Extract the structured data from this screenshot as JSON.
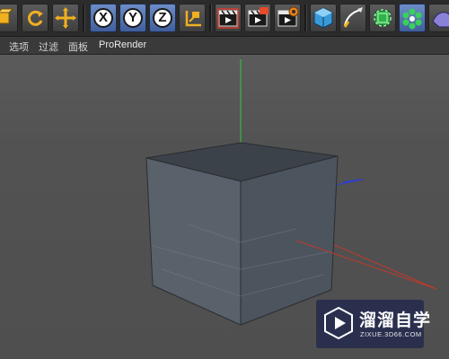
{
  "toolbar": {
    "buttons": [
      {
        "icon": "model-mode-icon"
      },
      {
        "icon": "rotate-icon"
      },
      {
        "icon": "move-icon"
      },
      {
        "icon": "x-axis-lock-icon",
        "label": "X"
      },
      {
        "icon": "y-axis-lock-icon",
        "label": "Y"
      },
      {
        "icon": "z-axis-lock-icon",
        "label": "Z"
      },
      {
        "icon": "coordinate-system-icon"
      },
      {
        "icon": "render-view-icon"
      },
      {
        "icon": "render-to-picture-viewer-icon"
      },
      {
        "icon": "render-settings-icon"
      },
      {
        "icon": "cube-object-icon"
      },
      {
        "icon": "pen-spline-icon"
      },
      {
        "icon": "subdivision-surface-icon"
      },
      {
        "icon": "cloner-mograph-icon"
      },
      {
        "icon": "deformer-icon"
      }
    ],
    "accent": "#3e5d9a"
  },
  "menubar": {
    "items": [
      "选项",
      "过滤",
      "面板",
      "ProRender"
    ]
  },
  "viewport": {
    "background": "#4f4f4f",
    "axis_colors": {
      "x": "#c0392b",
      "y": "#2ecc40",
      "z": "#2f3fd0"
    },
    "object": "cube"
  },
  "watermark": {
    "title": "溜溜自学",
    "url": "ZIXUE.3D66.COM"
  }
}
